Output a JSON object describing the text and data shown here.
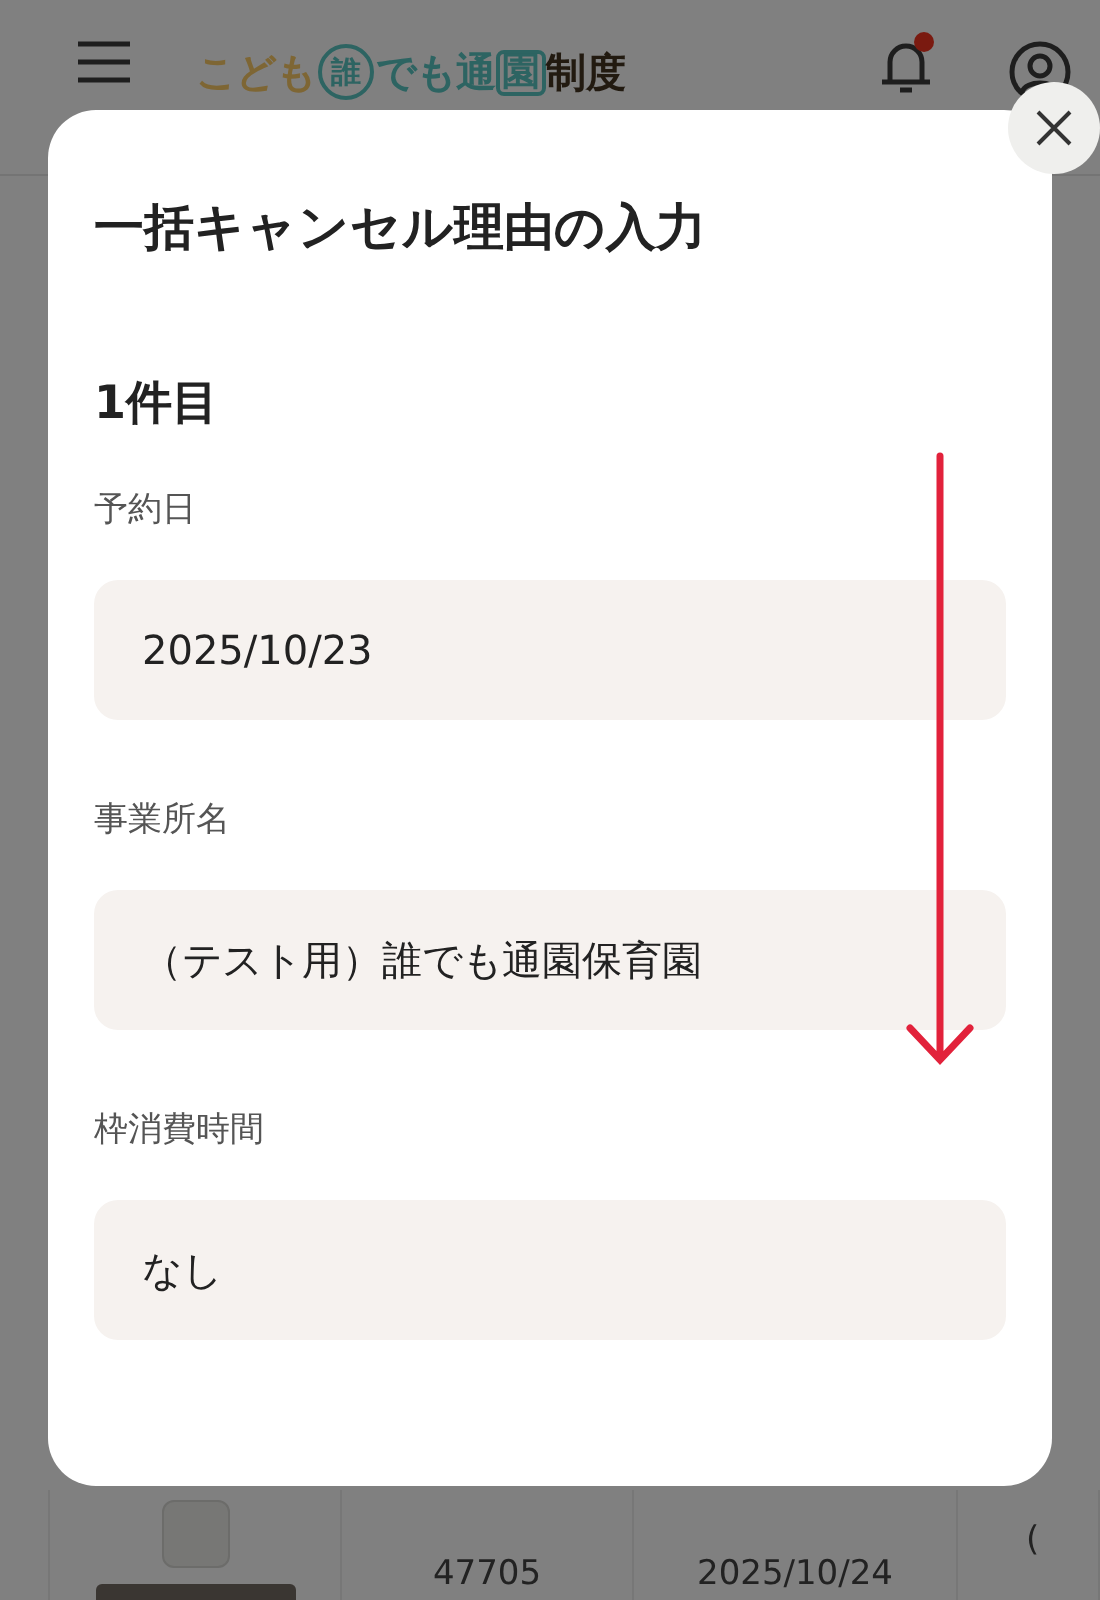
{
  "header": {
    "logo": [
      {
        "text": "こども",
        "kind": "gold"
      },
      {
        "text": "誰",
        "kind": "circled"
      },
      {
        "text": "でも通",
        "kind": "teal"
      },
      {
        "text": "園",
        "kind": "boxed"
      },
      {
        "text": "制度",
        "kind": "brown"
      }
    ],
    "notification": true
  },
  "table_row": {
    "checked": false,
    "id": "47705",
    "date": "2025/10/24",
    "column_4": "("
  },
  "modal": {
    "title": "一括キャンセル理由の入力",
    "item_heading": "1件目",
    "fields": [
      {
        "label": "予約日",
        "value": "2025/10/23"
      },
      {
        "label": "事業所名",
        "value": "（テスト用）誰でも通園保育園"
      },
      {
        "label": "枠消費時間",
        "value": "なし"
      }
    ]
  }
}
